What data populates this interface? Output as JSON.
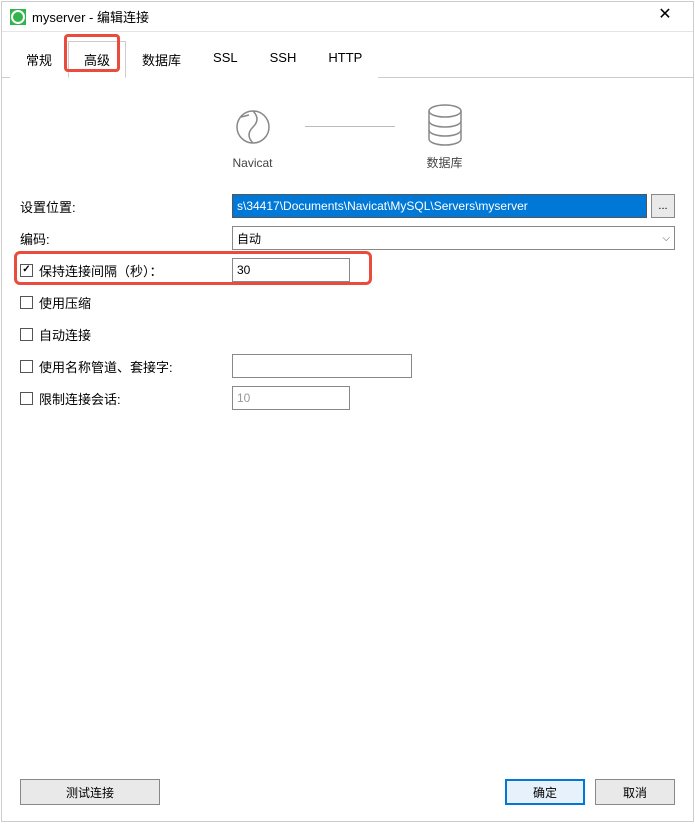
{
  "window": {
    "title": "myserver - 编辑连接"
  },
  "tabs": {
    "items": [
      {
        "label": "常规"
      },
      {
        "label": "高级"
      },
      {
        "label": "数据库"
      },
      {
        "label": "SSL"
      },
      {
        "label": "SSH"
      },
      {
        "label": "HTTP"
      }
    ],
    "active_index": 1
  },
  "diagram": {
    "left_label": "Navicat",
    "right_label": "数据库"
  },
  "form": {
    "location": {
      "label": "设置位置:",
      "value": "s\\34417\\Documents\\Navicat\\MySQL\\Servers\\myserver",
      "browse": "..."
    },
    "encoding": {
      "label": "编码:",
      "value": "自动"
    },
    "keepalive": {
      "label": "保持连接间隔（秒）：",
      "checked": true,
      "value": "30"
    },
    "compression": {
      "label": "使用压缩",
      "checked": false
    },
    "autoconnect": {
      "label": "自动连接",
      "checked": false
    },
    "namedpipe": {
      "label": "使用名称管道、套接字:",
      "checked": false,
      "value": ""
    },
    "limit_sessions": {
      "label": "限制连接会话:",
      "checked": false,
      "value": "10"
    }
  },
  "buttons": {
    "test": "测试连接",
    "ok": "确定",
    "cancel": "取消"
  },
  "highlight_color": "#e94b3c"
}
